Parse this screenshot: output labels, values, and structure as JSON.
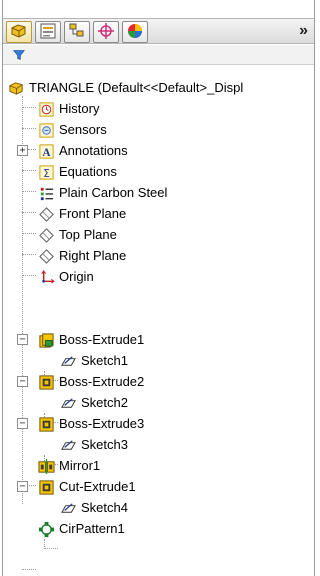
{
  "toolbar": {
    "tabs": [
      {
        "name": "featuremanager-tab",
        "icon": "featuremanager-icon"
      },
      {
        "name": "propertymanager-tab",
        "icon": "propertymanager-icon"
      },
      {
        "name": "configurationmanager-tab",
        "icon": "configurationmanager-icon"
      },
      {
        "name": "dimxpert-tab",
        "icon": "dimxpert-icon"
      },
      {
        "name": "display-manager-tab",
        "icon": "display-manager-icon"
      }
    ],
    "more_label": "»"
  },
  "filter": {
    "icon": "filter-icon"
  },
  "tree": {
    "root": "TRIANGLE  (Default<<Default>_Displ",
    "items": [
      {
        "label": "History",
        "icon": "history-icon"
      },
      {
        "label": "Sensors",
        "icon": "sensors-icon"
      },
      {
        "label": "Annotations",
        "icon": "annotations-icon"
      },
      {
        "label": "Equations",
        "icon": "equations-icon"
      },
      {
        "label": "Plain Carbon Steel",
        "icon": "material-icon"
      },
      {
        "label": "Front Plane",
        "icon": "plane-icon"
      },
      {
        "label": "Top Plane",
        "icon": "plane-icon"
      },
      {
        "label": "Right Plane",
        "icon": "plane-icon"
      },
      {
        "label": "Origin",
        "icon": "origin-icon"
      },
      {
        "label": "Boss-Extrude1",
        "icon": "boss-extrude-icon"
      },
      {
        "label": "Sketch1",
        "icon": "sketch-icon"
      },
      {
        "label": "Boss-Extrude2",
        "icon": "boss-extrude-icon"
      },
      {
        "label": "Sketch2",
        "icon": "sketch-icon"
      },
      {
        "label": "Boss-Extrude3",
        "icon": "boss-extrude-icon"
      },
      {
        "label": "Sketch3",
        "icon": "sketch-icon"
      },
      {
        "label": "Mirror1",
        "icon": "mirror-icon"
      },
      {
        "label": "Cut-Extrude1",
        "icon": "cut-extrude-icon"
      },
      {
        "label": "Sketch4",
        "icon": "sketch-icon"
      },
      {
        "label": "CirPattern1",
        "icon": "circular-pattern-icon"
      }
    ]
  },
  "colors": {
    "feature_yellow": "#f5c400",
    "feature_dark": "#3a3a3a",
    "sketch_blue": "#1f3b8a",
    "pattern_green": "#1b7d2a"
  }
}
